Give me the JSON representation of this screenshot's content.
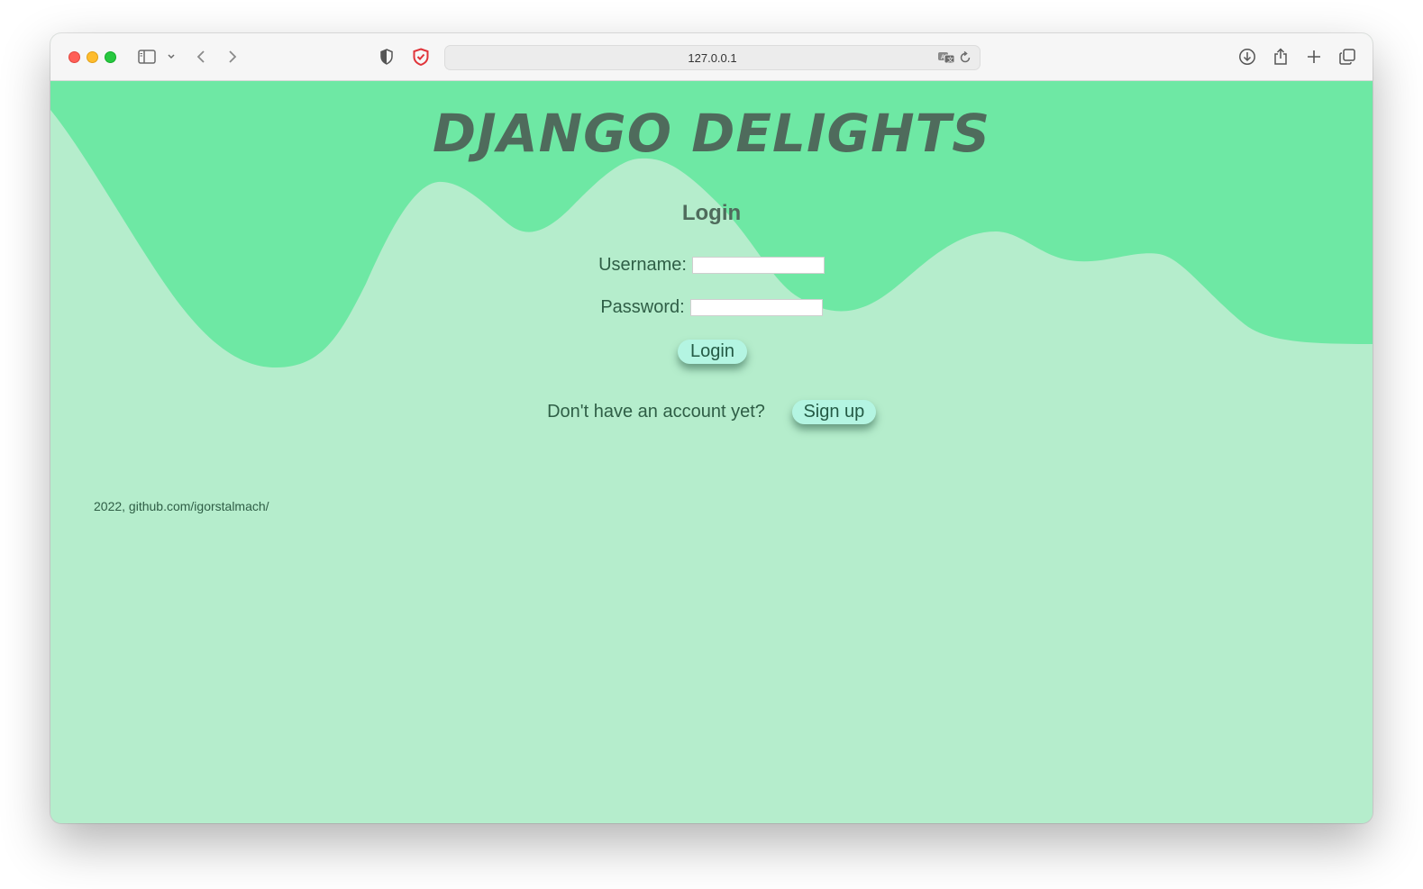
{
  "browser": {
    "url": "127.0.0.1",
    "icons": [
      "sidebar-icon",
      "chevron-down-icon",
      "back-icon",
      "forward-icon",
      "privacy-shield-icon",
      "security-extension-icon",
      "translate-icon",
      "reload-icon",
      "download-icon",
      "share-icon",
      "new-tab-icon",
      "tabs-overview-icon"
    ]
  },
  "site": {
    "title": "DJANGO DELIGHTS"
  },
  "login_form": {
    "heading": "Login",
    "username_label": "Username:",
    "username_value": "",
    "password_label": "Password:",
    "password_value": "",
    "submit_label": "Login"
  },
  "signup": {
    "prompt": "Don't have an account yet?",
    "button_label": "Sign up"
  },
  "footer": {
    "text": "2022, github.com/igorstalmach/"
  },
  "colors": {
    "background": "#b5edcc",
    "wave": "#6ee8a4",
    "title": "#4f6b5c",
    "button": "#b4f5e2",
    "text": "#2f5e46"
  }
}
